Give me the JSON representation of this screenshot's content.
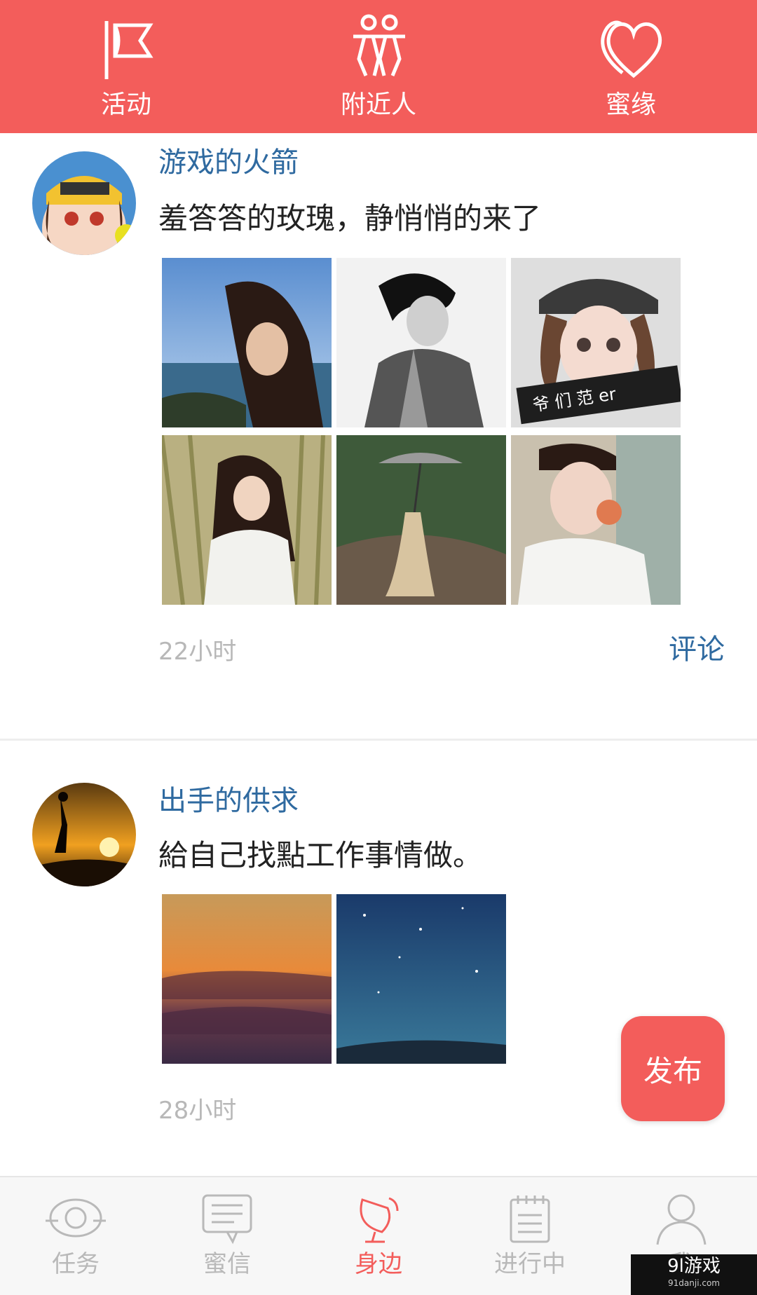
{
  "top_tabs": [
    {
      "label": "活动",
      "icon": "flag-icon"
    },
    {
      "label": "附近人",
      "icon": "people-icon"
    },
    {
      "label": "蜜缘",
      "icon": "heart-icon"
    }
  ],
  "posts": [
    {
      "username": "游戏的火箭",
      "content": "羞答答的玫瑰，静悄悄的来了",
      "photo_count": 6,
      "time": "22小时",
      "comment_label": "评论"
    },
    {
      "username": "出手的供求",
      "content": "給自己找點工作事情做。",
      "photo_count": 2,
      "time": "28小时"
    }
  ],
  "fab_label": "发布",
  "bottom_nav": [
    {
      "label": "任务",
      "icon": "task-icon"
    },
    {
      "label": "蜜信",
      "icon": "message-icon"
    },
    {
      "label": "身边",
      "icon": "nearby-icon",
      "active": true
    },
    {
      "label": "进行中",
      "icon": "calendar-icon"
    },
    {
      "label": "我",
      "icon": "profile-icon"
    }
  ],
  "watermark": {
    "brand": "9l游戏",
    "site": "91danji.com"
  },
  "colors": {
    "accent": "#f35d5b",
    "name_blue": "#2f6aa0",
    "muted": "#b8b8b8"
  }
}
